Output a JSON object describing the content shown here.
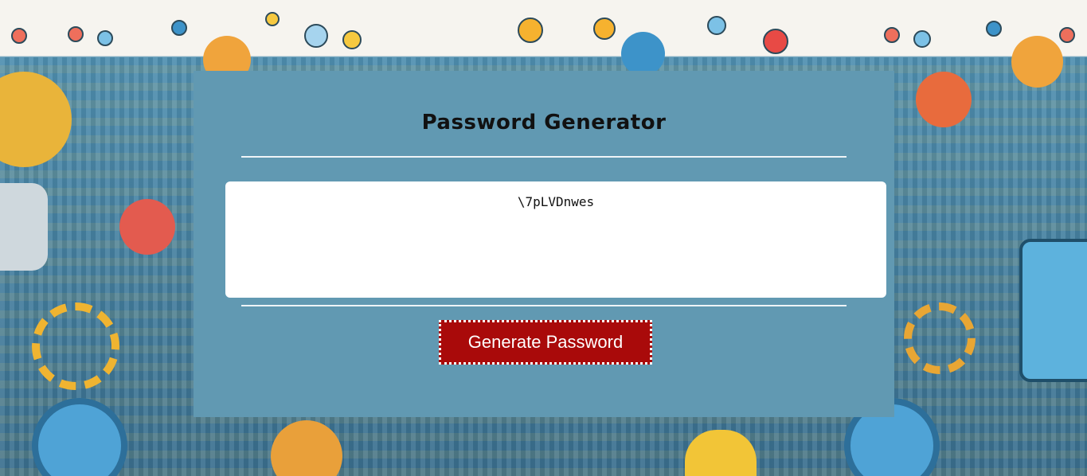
{
  "page": {
    "title": "Password Generator"
  },
  "password": {
    "value": "\\7pLVDnwes"
  },
  "actions": {
    "generate_label": "Generate Password"
  },
  "colors": {
    "card_background": "#6199b2",
    "button_background": "#a90a0a",
    "divider": "#eef4f7",
    "password_box": "#ffffff"
  }
}
